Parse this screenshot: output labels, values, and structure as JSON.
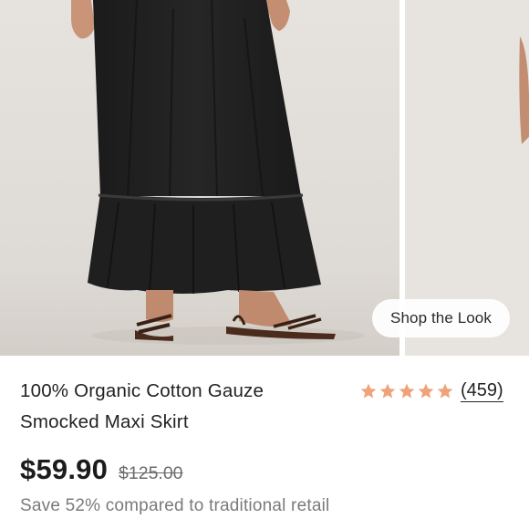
{
  "carousel": {
    "main_image": "product-photo-black-maxi-skirt",
    "next_image": "product-photo-partial",
    "shop_the_look_label": "Shop the Look"
  },
  "product": {
    "title": "100% Organic Cotton Gauze Smocked Maxi Skirt",
    "rating_value": 5,
    "rating_max": 5,
    "review_count": "(459)",
    "price": "$59.90",
    "compare_at_price": "$125.00",
    "savings_text": "Save 52% compared to traditional retail"
  },
  "colors": {
    "star": "#f0a37a",
    "text": "#222222",
    "muted": "#7a7a7a",
    "image_bg": "#e3dfdb"
  }
}
